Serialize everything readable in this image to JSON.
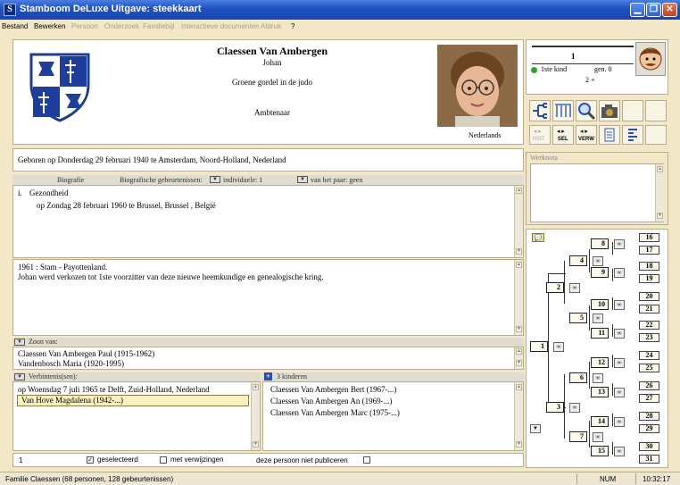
{
  "window": {
    "title": "Stamboom DeLuxe Uitgave: steekkaart",
    "icon_letter": "S"
  },
  "menu": [
    {
      "label": "Bestand",
      "enabled": true
    },
    {
      "label": "Bewerken",
      "enabled": true
    },
    {
      "label": "Persoon",
      "enabled": false
    },
    {
      "label": "Onderzoek",
      "enabled": false
    },
    {
      "label": "Familiebijl",
      "enabled": false
    },
    {
      "label": "Interactieve documenten",
      "enabled": false
    },
    {
      "label": "Afdruk",
      "enabled": false
    },
    {
      "label": "?",
      "enabled": true
    }
  ],
  "person": {
    "surname": "Claessen Van Ambergen",
    "firstname": "Johan",
    "title_line": "Groene gordel in de judo",
    "occupation": "Ambtenaar",
    "nationality": "Nederlands",
    "birth": "Geboren op Donderdag 29 februari 1940 te Amsterdam, Noord-Holland, Nederland"
  },
  "counters": {
    "number": "1",
    "kind_label": "1ste kind",
    "gen_label": "gen. 0",
    "plus": "2 +"
  },
  "toolbar": {
    "btn1": "HIST",
    "btn2": "SEL",
    "btn3": "VERW"
  },
  "events_header": {
    "col1": "Biografie",
    "col2": "Biografische gebeurtenissen:",
    "col3": "individuele: 1",
    "col4": "van het paar: geen"
  },
  "events": {
    "item_marker": "i.",
    "item_title": "Gezondheid",
    "item_detail": "op Zondag 28 februari 1960 te Brussel, Brussel , België"
  },
  "biography": {
    "line1": "1961 : Stam - Payottenland.",
    "line2": "Johan werd verkozen tot 1ste voorzitter van deze nieuwe heemkundige en genealogische kring."
  },
  "parents": {
    "header": "Zoon van:",
    "father": "Claessen Van Ambergen Paul (1915-1962)",
    "mother": "Vandenbosch Maria (1920-1995)"
  },
  "unions": {
    "header": "Verbintenis(sen):",
    "date": "op Woensdag 7 juli 1965 te Delft, Zuid-Holland, Nederland",
    "partner": "Van Hove Magdalena (1942-...)"
  },
  "children": {
    "header": "3 kinderen",
    "list": [
      "Claessen Van Ambergen Bert (1967-...)",
      "Claessen Van Ambergen An (1969-...)",
      "Claessen Van Ambergen Marc (1975-...)"
    ]
  },
  "bottom": {
    "count": "1",
    "selected": "geselecteerd",
    "refs": "met verwijzingen",
    "nopub": "deze persoon niet publiceren"
  },
  "notes": {
    "label": "Werknota"
  },
  "tree": {
    "n1": "1",
    "n2": "2",
    "n3": "3",
    "n4": "4",
    "n5": "5",
    "n6": "6",
    "n7": "7",
    "n8": "8",
    "n9": "9",
    "n10": "10",
    "n11": "11",
    "n12": "12",
    "n13": "13",
    "n14": "14",
    "n15": "15",
    "n16": "16",
    "n17": "17",
    "n18": "18",
    "n19": "19",
    "n20": "20",
    "n21": "21",
    "n22": "22",
    "n23": "23",
    "n24": "24",
    "n25": "25",
    "n26": "26",
    "n27": "27",
    "n28": "28",
    "n29": "29",
    "n30": "30",
    "n31": "31",
    "inf": "∞"
  },
  "status": {
    "text": "Familie Claessen (68 personen, 128 gebeurtenissen)",
    "num": "NUM",
    "time": "10:32:17"
  }
}
